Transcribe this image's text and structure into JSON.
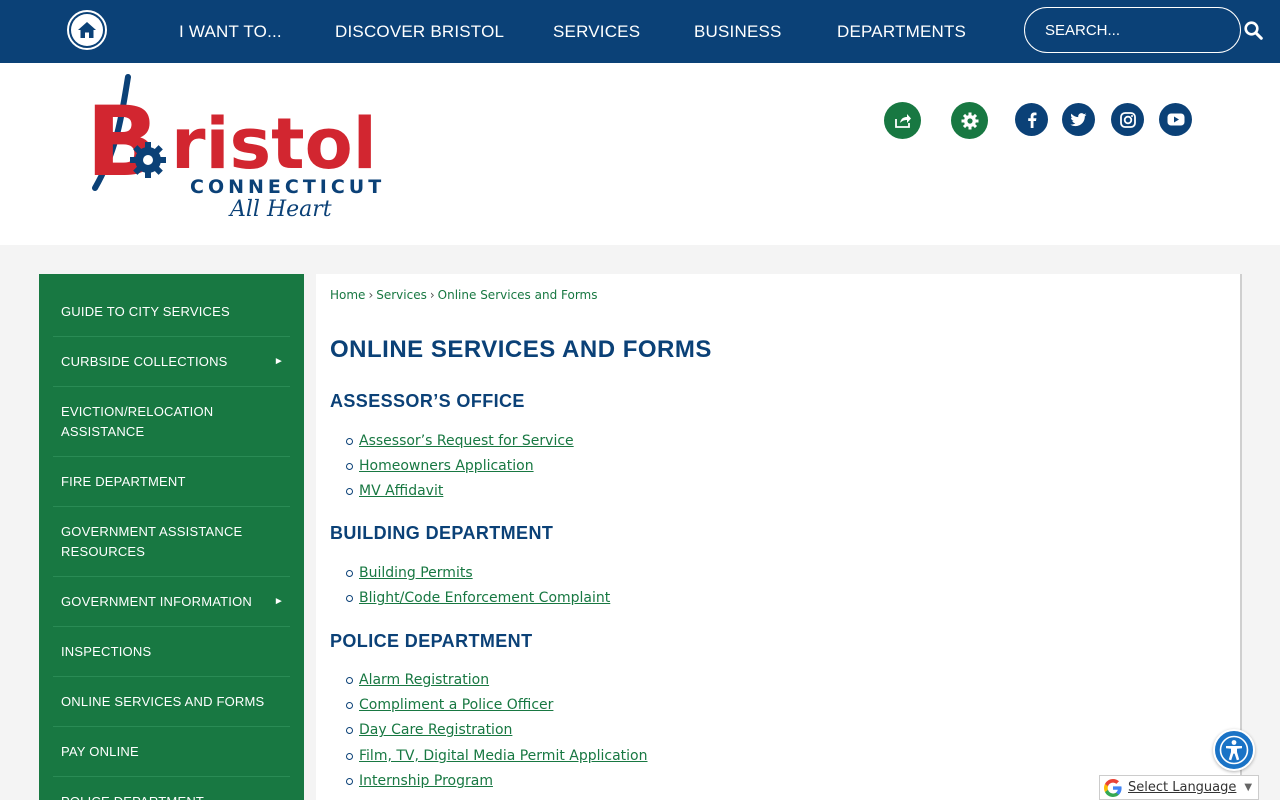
{
  "nav": {
    "items": [
      {
        "label": "I WANT TO..."
      },
      {
        "label": "DISCOVER BRISTOL"
      },
      {
        "label": "SERVICES"
      },
      {
        "label": "BUSINESS"
      },
      {
        "label": "DEPARTMENTS"
      }
    ],
    "search_placeholder": "SEARCH..."
  },
  "logo": {
    "name": "Bristol",
    "state": "CONNECTICUT",
    "tagline": "All Heart"
  },
  "header_icons": [
    "share-icon",
    "gear-icon",
    "facebook-icon",
    "twitter-icon",
    "instagram-icon",
    "youtube-icon"
  ],
  "sidebar": {
    "items": [
      {
        "label": "GUIDE TO CITY SERVICES",
        "has_submenu": false
      },
      {
        "label": "CURBSIDE COLLECTIONS",
        "has_submenu": true
      },
      {
        "label": "EVICTION/RELOCATION ASSISTANCE",
        "has_submenu": false
      },
      {
        "label": "FIRE DEPARTMENT",
        "has_submenu": false
      },
      {
        "label": "GOVERNMENT ASSISTANCE RESOURCES",
        "has_submenu": false
      },
      {
        "label": "GOVERNMENT INFORMATION",
        "has_submenu": true
      },
      {
        "label": "INSPECTIONS",
        "has_submenu": false
      },
      {
        "label": "ONLINE SERVICES AND FORMS",
        "has_submenu": false
      },
      {
        "label": "PAY ONLINE",
        "has_submenu": false
      },
      {
        "label": "POLICE DEPARTMENT",
        "has_submenu": false
      }
    ]
  },
  "breadcrumb": [
    "Home",
    "Services",
    "Online Services and Forms"
  ],
  "page_title": "ONLINE SERVICES AND FORMS",
  "sections": [
    {
      "title": "ASSESSOR’S OFFICE",
      "links": [
        "Assessor’s Request for Service",
        "Homeowners Application",
        "MV Affidavit"
      ]
    },
    {
      "title": "BUILDING DEPARTMENT",
      "links": [
        "Building Permits",
        "Blight/Code Enforcement Complaint"
      ]
    },
    {
      "title": "POLICE DEPARTMENT",
      "links": [
        "Alarm Registration",
        "Compliment a Police Officer",
        "Day Care Registration",
        "Film, TV, Digital Media Permit Application",
        "Internship Program"
      ]
    }
  ],
  "translate": {
    "label": "Select Language",
    "caret": "▼"
  },
  "colors": {
    "brand_blue": "#0b4177",
    "brand_green": "#187842",
    "logo_red": "#d22630",
    "page_bg": "#f4f4f4"
  }
}
